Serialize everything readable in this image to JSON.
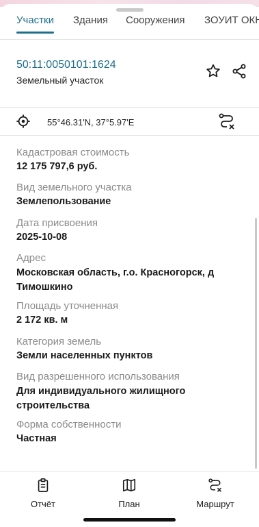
{
  "tabs": [
    {
      "label": "Участки",
      "active": true
    },
    {
      "label": "Здания",
      "active": false
    },
    {
      "label": "Сооружения",
      "active": false
    },
    {
      "label": "ЗОУИТ ОКН",
      "active": false
    }
  ],
  "parcel": {
    "cadastral_number": "50:11:0050101:1624",
    "type": "Земельный участок"
  },
  "location": {
    "coordinates": "55°46.31'N, 37°5.97'E"
  },
  "fields": [
    {
      "label": "Кадастровая стоимость",
      "value": "12 175 797,6 руб."
    },
    {
      "label": "Вид земельного участка",
      "value": "Землепользование"
    },
    {
      "label": "Дата присвоения",
      "value": "2025-10-08"
    },
    {
      "label": "Адрес",
      "value": "Московская область, г.о. Красногорск, д Тимошкино"
    },
    {
      "label": "Площадь уточненная",
      "value": "2 172 кв. м"
    },
    {
      "label": "Категория земель",
      "value": "Земли населенных пунктов"
    },
    {
      "label": "Вид разрешенного использования",
      "value": "Для индивидуального жилищного строительства"
    },
    {
      "label": "Форма собственности",
      "value": "Частная"
    }
  ],
  "bottom_nav": [
    {
      "label": "Отчёт",
      "icon": "report-icon"
    },
    {
      "label": "План",
      "icon": "map-icon"
    },
    {
      "label": "Маршрут",
      "icon": "route-icon"
    }
  ],
  "colors": {
    "accent": "#1f6f8b",
    "label_gray": "#8a8a8a"
  }
}
